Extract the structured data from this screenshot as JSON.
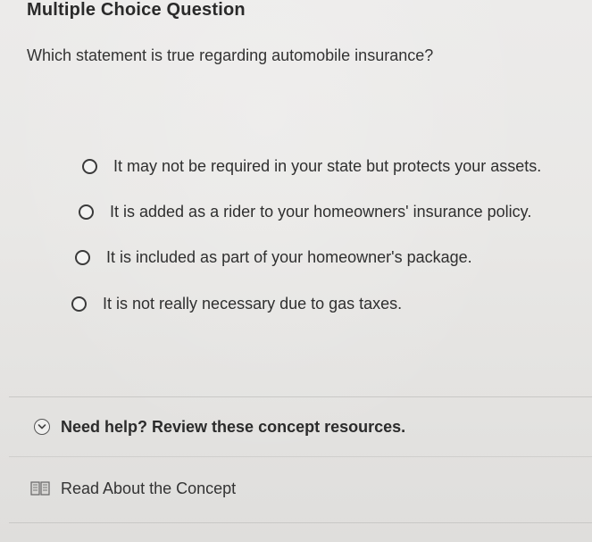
{
  "question": {
    "type_label": "Multiple Choice Question",
    "prompt": "Which statement is true regarding automobile insurance?"
  },
  "options": [
    {
      "label": "It may not be required in your state but protects your assets.",
      "selected": false
    },
    {
      "label": "It is added as a rider to your homeowners' insurance policy.",
      "selected": false
    },
    {
      "label": "It is included as part of your homeowner's package.",
      "selected": false
    },
    {
      "label": "It is not really necessary due to gas taxes.",
      "selected": false
    }
  ],
  "help": {
    "title": "Need help? Review these concept resources.",
    "expand_icon": "chevron-down-circle-icon",
    "concept_link": "Read About the Concept",
    "concept_icon": "book-icon"
  }
}
